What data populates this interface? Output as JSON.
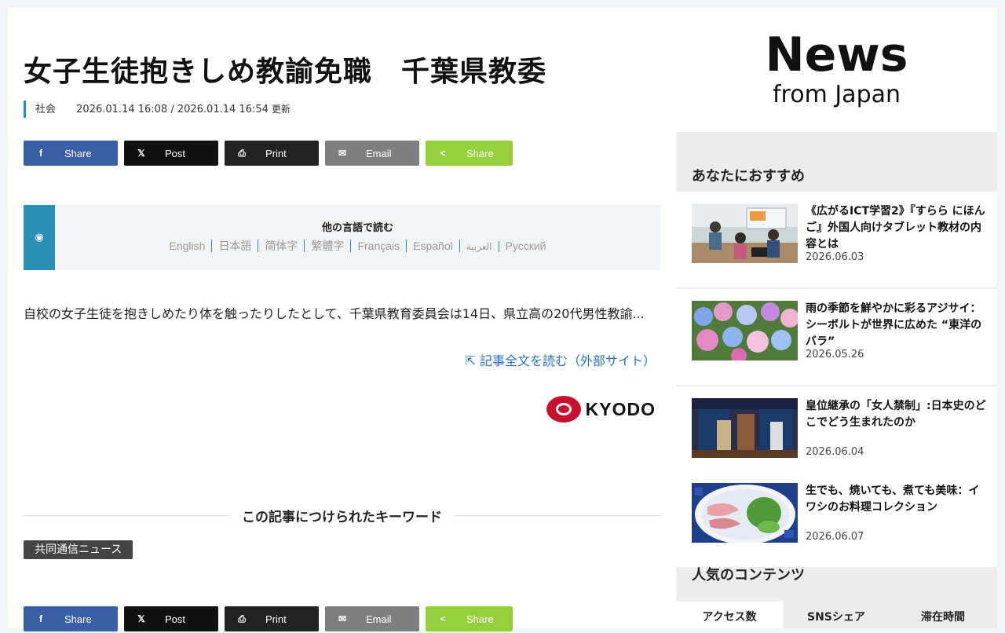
{
  "article": {
    "title": "女子生徒抱きしめ教諭免職　千葉県教委",
    "category": "社会",
    "dates": "2026.01.14 16:08 / 2026.01.14 16:54",
    "updated_label": "更新",
    "body": "自校の女子生徒を抱きしめたり体を触ったりしたとして、千葉県教育委員会は14日、県立高の20代男性教諭...",
    "external_link": "記事全文を読む（外部サイト）",
    "source_logo_text": "KYODO"
  },
  "share_buttons": [
    {
      "icon": "f",
      "label": "Share"
    },
    {
      "icon": "𝕏",
      "label": "Post"
    },
    {
      "icon": "⎙",
      "label": "Print"
    },
    {
      "icon": "✉",
      "label": "Email"
    },
    {
      "icon": "<",
      "label": "Share"
    }
  ],
  "languages": {
    "title": "他の言語で読む",
    "items": [
      "English",
      "日本語",
      "简体字",
      "繁體字",
      "Français",
      "Español",
      "العربية",
      "Русский"
    ]
  },
  "keywords": {
    "heading": "この記事につけられたキーワード",
    "tags": [
      "共同通信ニュース"
    ]
  },
  "sidebar": {
    "brand_top": "News",
    "brand_bottom": "from Japan",
    "recommend_title": "あなたにおすすめ",
    "cards": [
      {
        "title": "《広がるICT学習2》『すらら にほんご』外国人向けタブレット教材の内容とは",
        "date": "2026.06.03",
        "thumb": "classroom"
      },
      {
        "title": "雨の季節を鮮やかに彩るアジサイ：シーボルトが世界に広めた “東洋のバラ”",
        "date": "2026.05.26",
        "thumb": "hydrangea"
      },
      {
        "title": "皇位継承の「女人禁制」:日本史のどこでどう生まれたのか",
        "date": "2026.06.04",
        "thumb": "ceremony"
      },
      {
        "title": "生でも、焼いても、煮ても美味：イワシのお料理コレクション",
        "date": "2026.06.07",
        "thumb": "sashimi"
      }
    ],
    "popular_title": "人気のコンテンツ",
    "tabs": [
      "アクセス数",
      "SNSシェア",
      "滞在時間"
    ]
  }
}
